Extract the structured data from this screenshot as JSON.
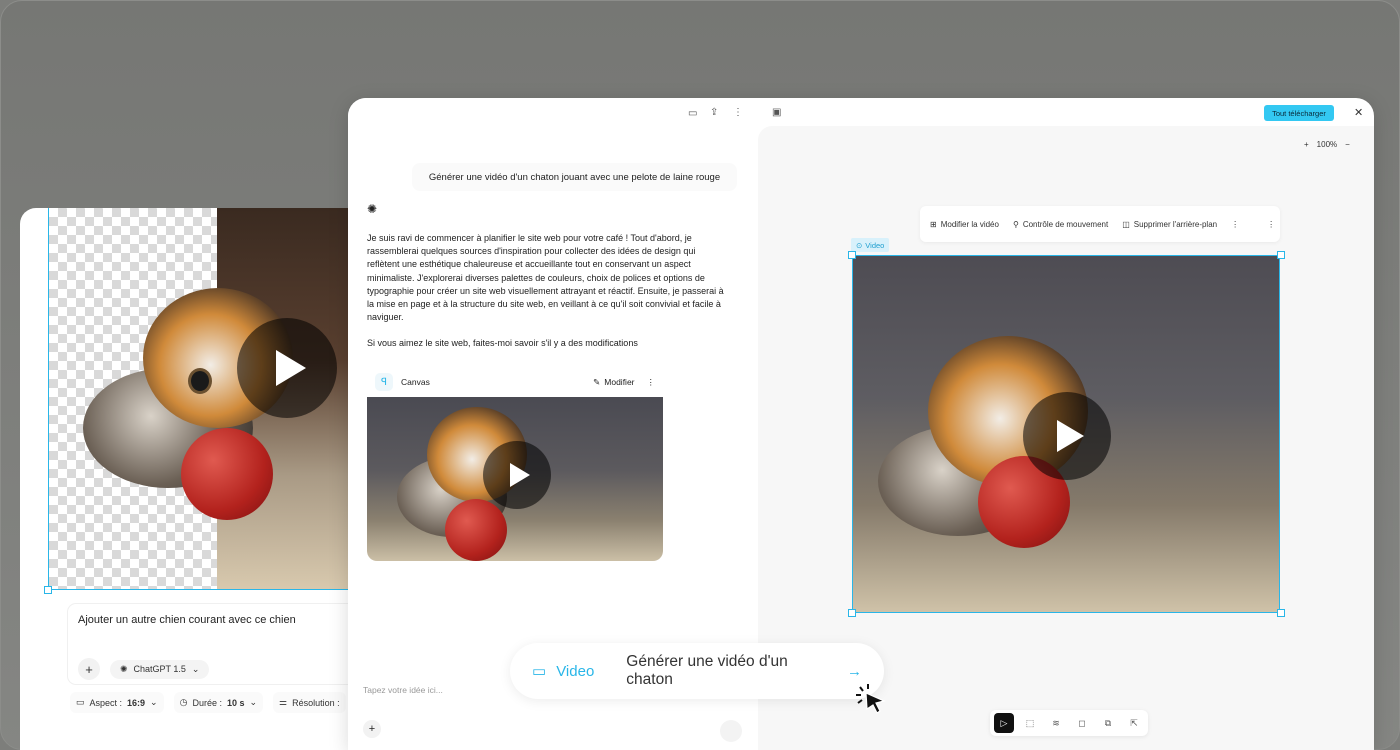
{
  "left_card": {
    "prompt": "Ajouter un autre chien courant avec ce chien",
    "model": "ChatGPT 1.5",
    "options": [
      {
        "label": "Aspect :",
        "value": "16:9"
      },
      {
        "label": "Durée :",
        "value": "10 s"
      },
      {
        "label": "Résolution :",
        "value": ""
      }
    ]
  },
  "window": {
    "download_all": "Tout télécharger",
    "zoom": "100%"
  },
  "chat": {
    "user_message": "Générer une vidéo d'un chaton jouant avec une pelote de laine rouge",
    "assistant_paragraph_1": "Je suis ravi de commencer à planifier le site web pour votre café ! Tout d'abord, je rassemblerai quelques sources d'inspiration pour collecter des idées de design qui reflètent une esthétique chaleureuse et accueillante tout en conservant un aspect minimaliste. J'explorerai diverses palettes de couleurs, choix de polices et options de typographie pour créer un site web visuellement attrayant et réactif. Ensuite, je passerai à la mise en page et à la structure du site web, en veillant à ce qu'il soit convivial et facile à naviguer.",
    "assistant_paragraph_2": "Si vous aimez le site web, faites-moi savoir s'il y a des modifications",
    "canvas_label": "Canvas",
    "modify_label": "Modifier",
    "input_placeholder": "Tapez votre idée ici..."
  },
  "canvas": {
    "toolbar": [
      "Modifier la vidéo",
      "Contrôle de mouvement",
      "Supprimer l'arrière-plan"
    ],
    "video_badge": "Video"
  },
  "prompt_pill": {
    "label": "Video",
    "text": "Générer une vidéo d'un chaton"
  },
  "colors": {
    "accent": "#29b6e8",
    "download_button": "#33c8f2"
  }
}
